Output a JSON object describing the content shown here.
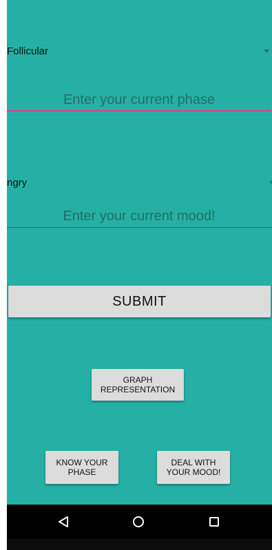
{
  "phase_section": {
    "spinner_value": "Follicular",
    "input_placeholder": "Enter your current phase",
    "underline_color": "#e0407a"
  },
  "mood_section": {
    "spinner_value": "ngry",
    "input_placeholder": "Enter your current mood!",
    "underline_color": "#1c6f68"
  },
  "buttons": {
    "submit_label": "SUBMIT",
    "graph_label_line1": "GRAPH",
    "graph_label_line2": "REPRESENTATION",
    "know_label_line1": "KNOW YOUR",
    "know_label_line2": "PHASE",
    "deal_label_line1": "DEAL WITH",
    "deal_label_line2": "YOUR MOOD!"
  },
  "nav_bar": {
    "icons": [
      "back-icon",
      "home-icon",
      "recents-icon"
    ]
  },
  "colors": {
    "background": "#26b0a5",
    "button": "#dcdcdc",
    "nav_bar": "#000000"
  }
}
